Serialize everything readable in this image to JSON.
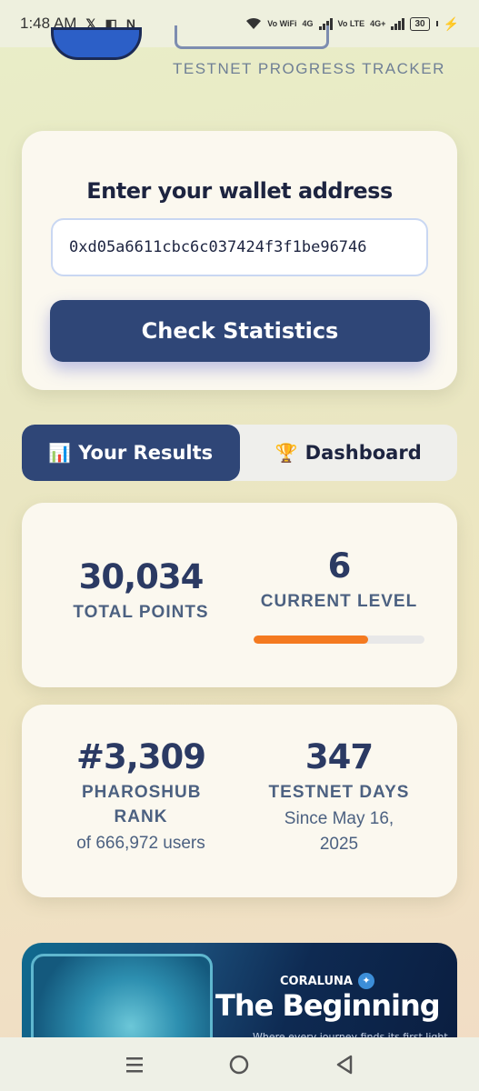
{
  "status_bar": {
    "time": "1:48 AM",
    "network_labels": [
      "Vo WiFi",
      "4G",
      "Vo LTE",
      "4G+"
    ],
    "battery": "30"
  },
  "header": {
    "subtitle": "TESTNET PROGRESS TRACKER"
  },
  "wallet": {
    "title": "Enter your wallet address",
    "address": "0xd05a6611cbc6c037424f3f1be96746",
    "button_label": "Check Statistics"
  },
  "tabs": [
    {
      "icon": "📊",
      "label": "Your Results",
      "active": true
    },
    {
      "icon": "🏆",
      "label": "Dashboard",
      "active": false
    }
  ],
  "stats": {
    "total_points": {
      "value": "30,034",
      "label": "TOTAL POINTS"
    },
    "current_level": {
      "value": "6",
      "label": "CURRENT LEVEL",
      "progress": 0.67
    },
    "rank": {
      "value": "#3,309",
      "label": "PHAROSHUB RANK",
      "sub": "of 666,972 users"
    },
    "testnet_days": {
      "value": "347",
      "label": "TESTNET DAYS",
      "sub": "Since May 16, 2025"
    }
  },
  "banner": {
    "brand": "CORALUNA",
    "title": "The Beginning",
    "tagline": "Where every journey finds its first light"
  },
  "colors": {
    "primary": "#2f4677",
    "accent": "#f47a20",
    "card": "#fbf8ef"
  }
}
